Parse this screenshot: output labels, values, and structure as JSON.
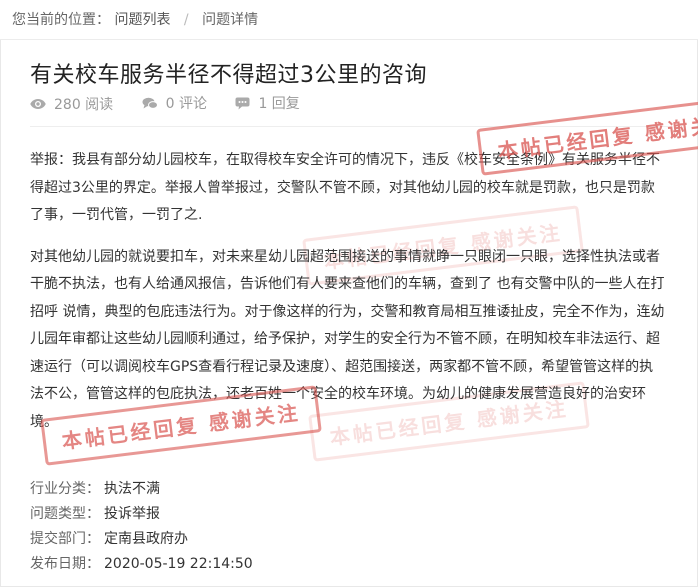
{
  "breadcrumb": {
    "location_label": "您当前的位置：",
    "items": [
      "问题列表",
      "问题详情"
    ],
    "separator": "/"
  },
  "question": {
    "title": "有关校车服务半径不得超过3公里的咨询",
    "views": "280 阅读",
    "comments": "0 评论",
    "replies": "1 回复",
    "paragraphs": [
      "举报：我县有部分幼儿园校车，在取得校车安全许可的情况下，违反《校车安全条例》有关服务半径不得超过3公里的界定。举报人曾举报过，交警队不管不顾，对其他幼儿园的校车就是罚款，也只是罚款了事，一罚代管，一罚了之.",
      "对其他幼儿园的就说要扣车，对未来星幼儿园超范围接送的事情就睁一只眼闭一只眼，选择性执法或者干脆不执法，也有人给通风报信，告诉他们有人要来查他们的车辆，查到了 也有交警中队的一些人在打招呼 说情，典型的包庇违法行为。对于像这样的行为，交警和教育局相互推诿扯皮，完全不作为，连幼儿园年审都让这些幼儿园顺利通过，给予保护，对学生的安全行为不管不顾，在明知校车非法运行、超速运行（可以调阅校车GPS查看行程记录及速度）、超范围接送，两家都不管不顾，希望管管这样的执法不公，管管这样的包庇执法，还老百姓一个安全的校车环境。为幼儿的健康发展营造良好的治安环境。"
    ],
    "stamp_text": "本帖已经回复 感谢关注"
  },
  "meta": [
    {
      "label": "行业分类：",
      "value": "执法不满"
    },
    {
      "label": "问题类型：",
      "value": "投诉举报"
    },
    {
      "label": "提交部门：",
      "value": "定南县政府办"
    },
    {
      "label": "发布日期：",
      "value": "2020-05-19 22:14:50"
    }
  ],
  "colors": {
    "stamp": "#d9534f",
    "muted": "#999999"
  },
  "icons": [
    "eye-icon",
    "comment-icon",
    "reply-icon"
  ]
}
